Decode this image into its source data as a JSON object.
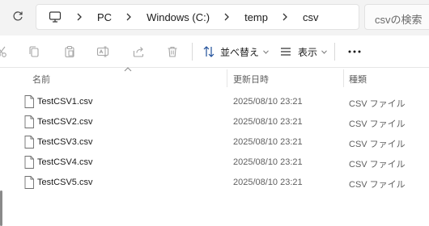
{
  "address_bar": {
    "breadcrumbs": [
      {
        "label": "PC"
      },
      {
        "label": "Windows (C:)"
      },
      {
        "label": "temp"
      },
      {
        "label": "csv"
      }
    ],
    "search_placeholder": "csvの検索"
  },
  "toolbar": {
    "sort_label": "並べ替え",
    "view_label": "表示",
    "icons": [
      "cut-icon",
      "copy-icon",
      "paste-icon",
      "rename-icon",
      "share-icon",
      "delete-icon"
    ]
  },
  "columns": {
    "name": "名前",
    "modified": "更新日時",
    "type": "種類"
  },
  "files": [
    {
      "name": "TestCSV1.csv",
      "modified": "2025/08/10 23:21",
      "type": "CSV ファイル"
    },
    {
      "name": "TestCSV2.csv",
      "modified": "2025/08/10 23:21",
      "type": "CSV ファイル"
    },
    {
      "name": "TestCSV3.csv",
      "modified": "2025/08/10 23:21",
      "type": "CSV ファイル"
    },
    {
      "name": "TestCSV4.csv",
      "modified": "2025/08/10 23:21",
      "type": "CSV ファイル"
    },
    {
      "name": "TestCSV5.csv",
      "modified": "2025/08/10 23:21",
      "type": "CSV ファイル"
    }
  ]
}
